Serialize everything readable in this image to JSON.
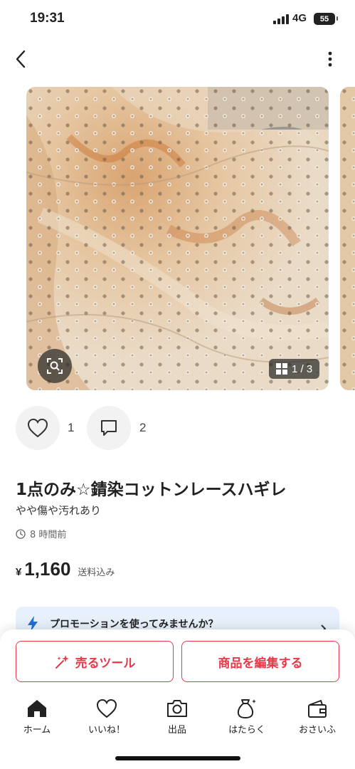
{
  "status_bar": {
    "time": "19:31",
    "network": "4G",
    "battery": "55"
  },
  "carousel": {
    "counter": "1 / 3"
  },
  "actions": {
    "like_count": "1",
    "comment_count": "2"
  },
  "item": {
    "title": "1点のみ☆錆染コットンレースハギレ",
    "condition": "やや傷や汚れあり",
    "posted": "8 時間前",
    "price_symbol": "¥",
    "price": "1,160",
    "price_note": "送料込み"
  },
  "promo": {
    "text": "プロモーションを使ってみませんか？"
  },
  "buttons": {
    "sell_tool": "売るツール",
    "edit_item": "商品を編集する"
  },
  "tabbar": {
    "home": "ホーム",
    "likes": "いいね！",
    "sell": "出品",
    "work": "はたらく",
    "wallet": "おさいふ"
  },
  "colors": {
    "accent": "#e8394a",
    "promo_bg": "#e8f1fb",
    "promo_icon": "#1f6fd6"
  }
}
